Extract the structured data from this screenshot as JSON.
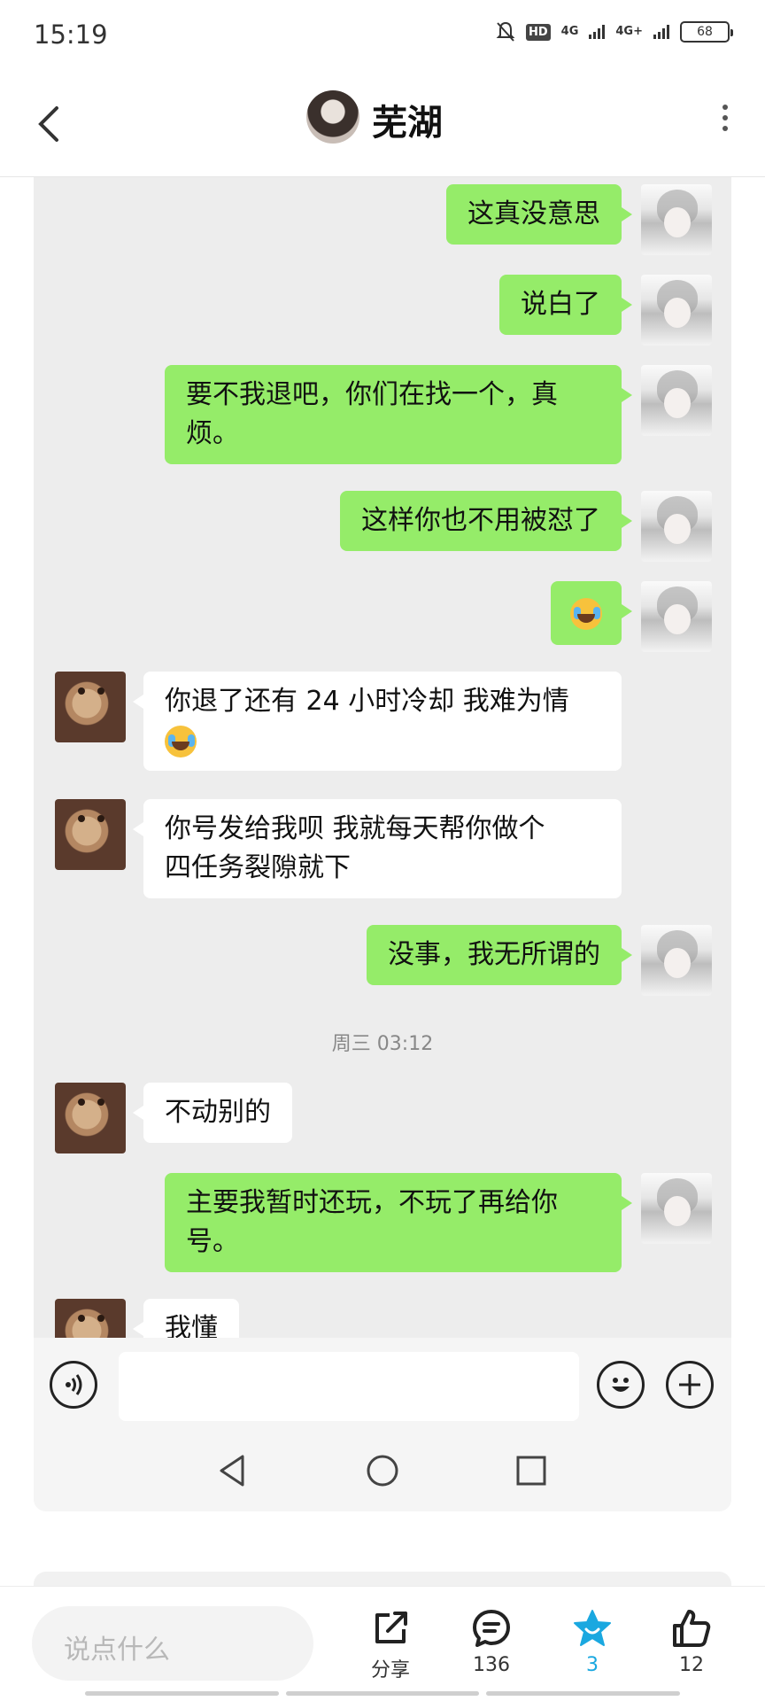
{
  "status_bar": {
    "time": "15:19",
    "signal1": "4G",
    "signal2": "4G+",
    "battery": "68"
  },
  "header": {
    "title": "芜湖"
  },
  "messages": [
    {
      "text": "这真没意思"
    },
    {
      "text": "说白了"
    },
    {
      "line1": "要不我退吧，你们在找一个，真",
      "line2": "烦。"
    },
    {
      "text": "这样你也不用被怼了"
    },
    {
      "emoji": "crying-laughing-emoji"
    },
    {
      "line1": "你退了还有 24 小时冷却 我难为情"
    },
    {
      "line1": "你号发给我呗 我就每天帮你做个",
      "line2": "四任务裂隙就下"
    },
    {
      "text": "没事，我无所谓的"
    },
    {
      "text": "不动别的"
    },
    {
      "line1": "主要我暂时还玩，不玩了再给你",
      "line2": "号。"
    },
    {
      "text": "我懂"
    }
  ],
  "timestamp": "周三 03:12",
  "bottom_bar": {
    "comment_placeholder": "说点什么",
    "share_label": "分享",
    "comments_count": "136",
    "favorites_count": "3",
    "likes_count": "12"
  },
  "colors": {
    "my_bubble": "#95ec69",
    "their_bubble": "#ffffff",
    "chat_bg": "#ededed",
    "accent": "#1aa8e0"
  }
}
